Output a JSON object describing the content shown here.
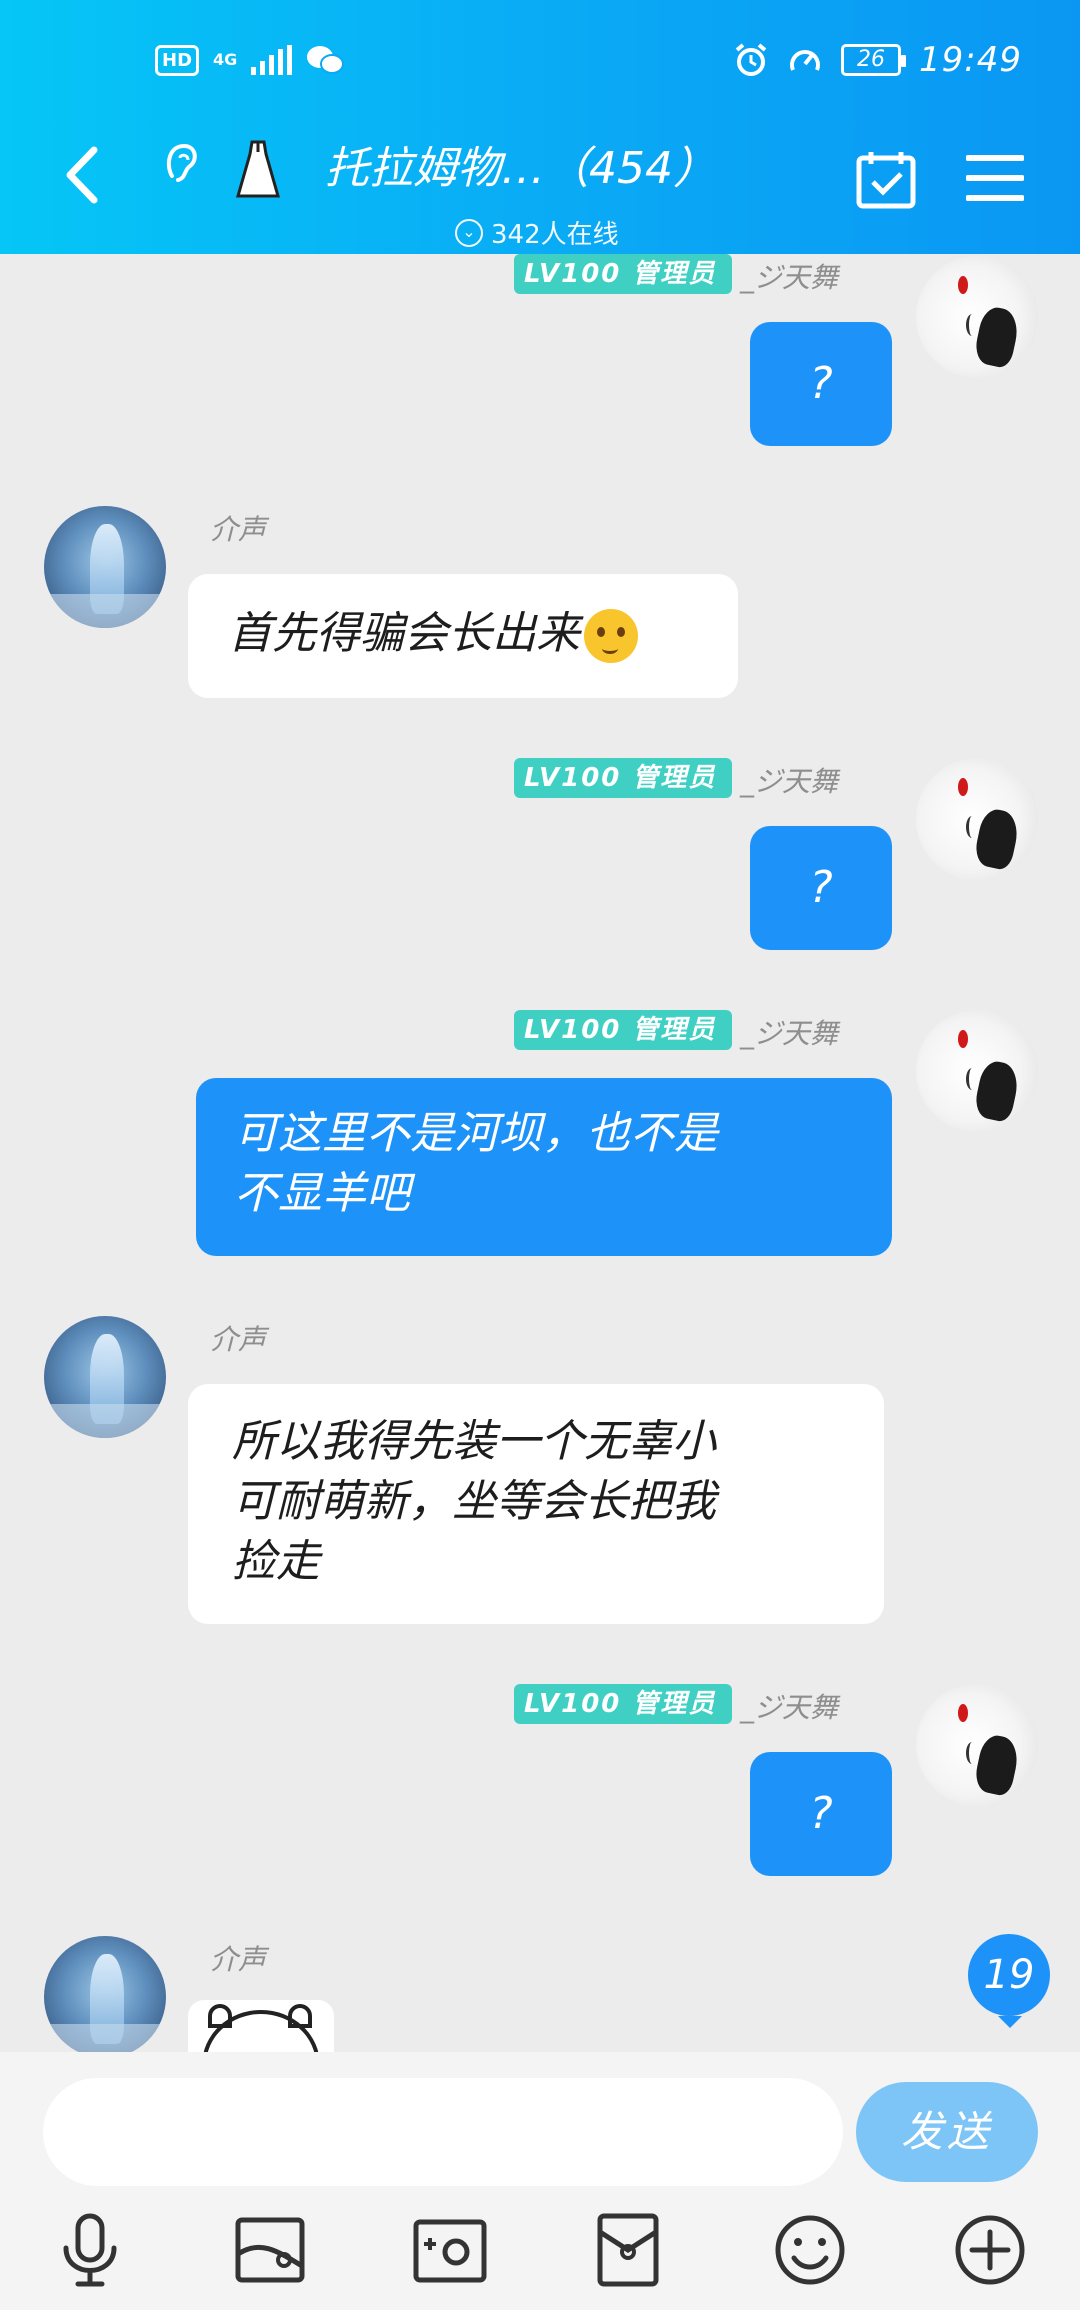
{
  "status_bar": {
    "hd": "HD",
    "network": "4G",
    "battery": "26",
    "time": "19:49"
  },
  "header": {
    "title": "托拉姆物…（454）",
    "online": "342人在线"
  },
  "messages": [
    {
      "side": "self",
      "badge": "LV100 管理员",
      "sender": "_ジ天舞",
      "text": "?"
    },
    {
      "side": "other",
      "sender": "介声",
      "text": "首先得骗会长出来"
    },
    {
      "side": "self",
      "badge": "LV100 管理员",
      "sender": "_ジ天舞",
      "text": "?"
    },
    {
      "side": "self",
      "badge": "LV100 管理员",
      "sender": "_ジ天舞",
      "lines": [
        "可这里不是河坝，也不是",
        "不显羊吧"
      ]
    },
    {
      "side": "other",
      "sender": "介声",
      "lines": [
        "所以我得先装一个无辜小",
        "可耐萌新，坐等会长把我",
        "捡走"
      ]
    },
    {
      "side": "self",
      "badge": "LV100 管理员",
      "sender": "_ジ天舞",
      "text": "?"
    },
    {
      "side": "other",
      "sender": "介声",
      "text": ""
    }
  ],
  "unread_count": "19",
  "composer": {
    "send_label": "发送"
  },
  "toolbar_icons": [
    "microphone-icon",
    "image-icon",
    "camera-icon",
    "red-packet-icon",
    "emoji-icon",
    "plus-icon"
  ],
  "colors": {
    "header_start": "#05c6f6",
    "header_end": "#0a97f3",
    "outgoing_bubble": "#1d92f8",
    "badge": "#3fd0c3",
    "send_button": "#7ec5f7"
  }
}
